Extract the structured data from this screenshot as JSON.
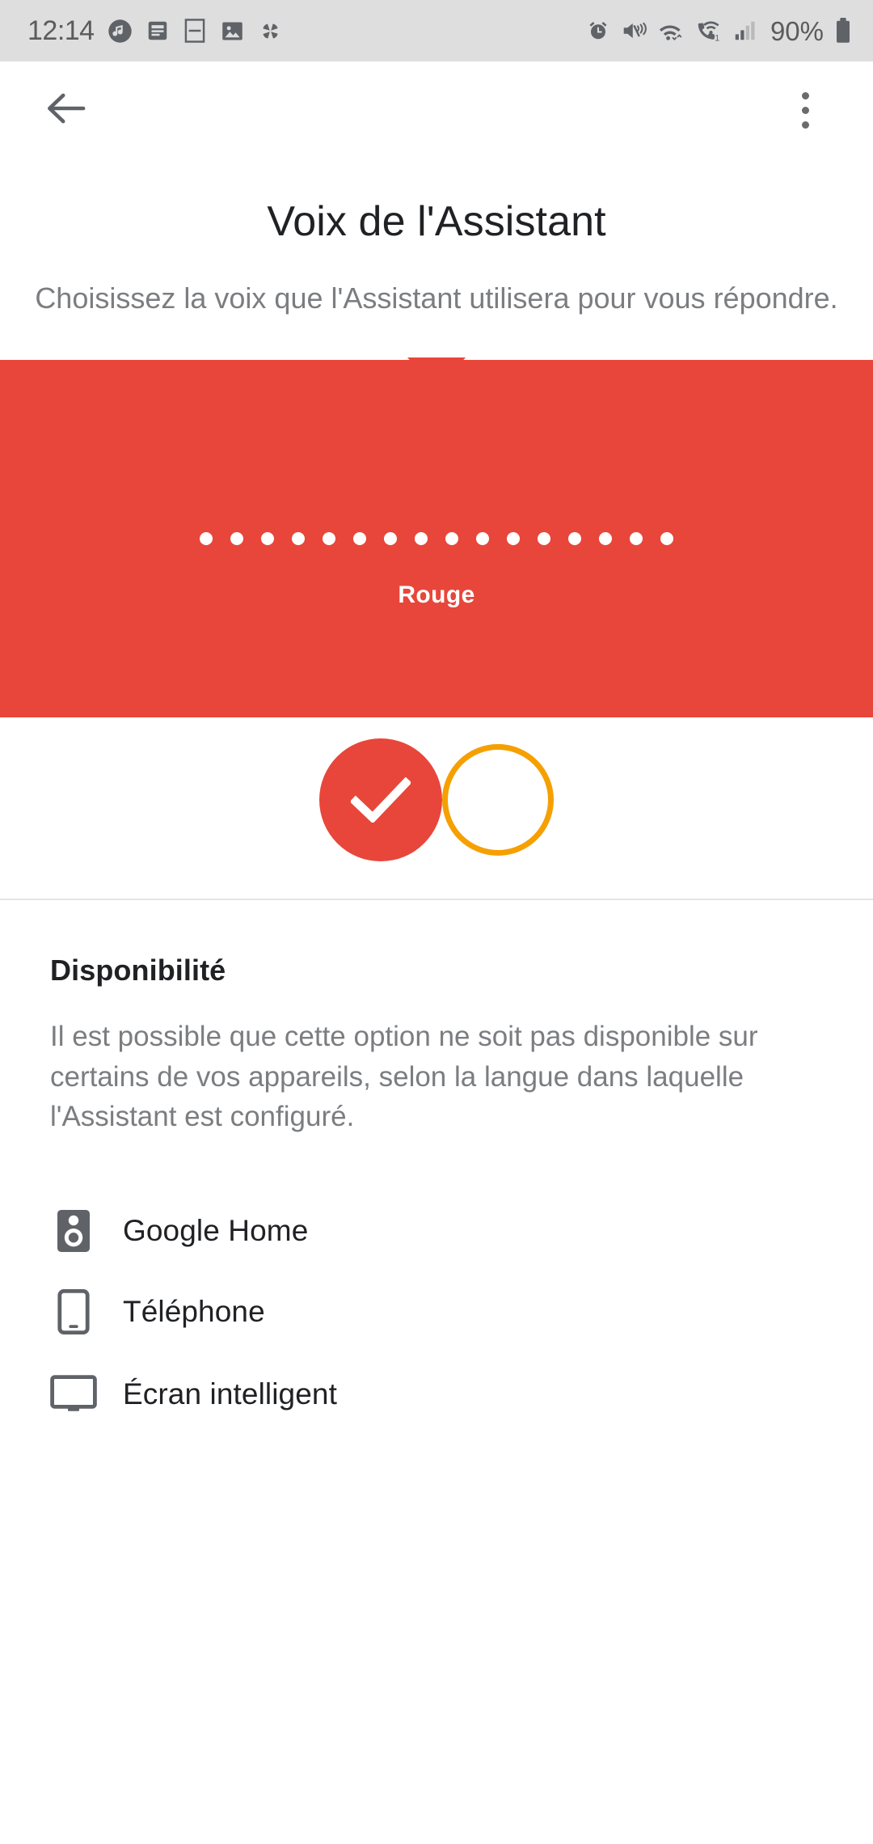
{
  "status_bar": {
    "time": "12:14",
    "battery_percent": "90%",
    "left_icons": [
      "music-note-icon",
      "news-feed-icon",
      "split-screen-icon",
      "photo-icon",
      "pinwheel-icon"
    ],
    "right_icons": [
      "alarm-icon",
      "vibrate-mute-icon",
      "wifi-icon",
      "wifi-calling-icon",
      "signal-bars-icon",
      "battery-icon"
    ]
  },
  "app_bar": {
    "back_label": "Retour",
    "overflow_label": "Plus d'options"
  },
  "header": {
    "title": "Voix de l'Assistant",
    "subtitle": "Choisissez la voix que l'Assistant utilisera pour vous répondre."
  },
  "preview": {
    "voice_name": "Rouge",
    "banner_color": "#e8463a",
    "dot_count": 16
  },
  "swatches": [
    {
      "name": "Rouge",
      "color": "#e8463a",
      "selected": true
    },
    {
      "name": "Orange",
      "color": "#f5a000",
      "selected": false
    }
  ],
  "availability": {
    "title": "Disponibilité",
    "body": "Il est possible que cette option ne soit pas disponible sur certains de vos appareils, selon la langue dans laquelle l'Assistant est configuré.",
    "devices": [
      {
        "icon": "speaker-icon",
        "label": "Google Home"
      },
      {
        "icon": "phone-icon",
        "label": "Téléphone"
      },
      {
        "icon": "smart-display-icon",
        "label": "Écran intelligent"
      }
    ]
  }
}
